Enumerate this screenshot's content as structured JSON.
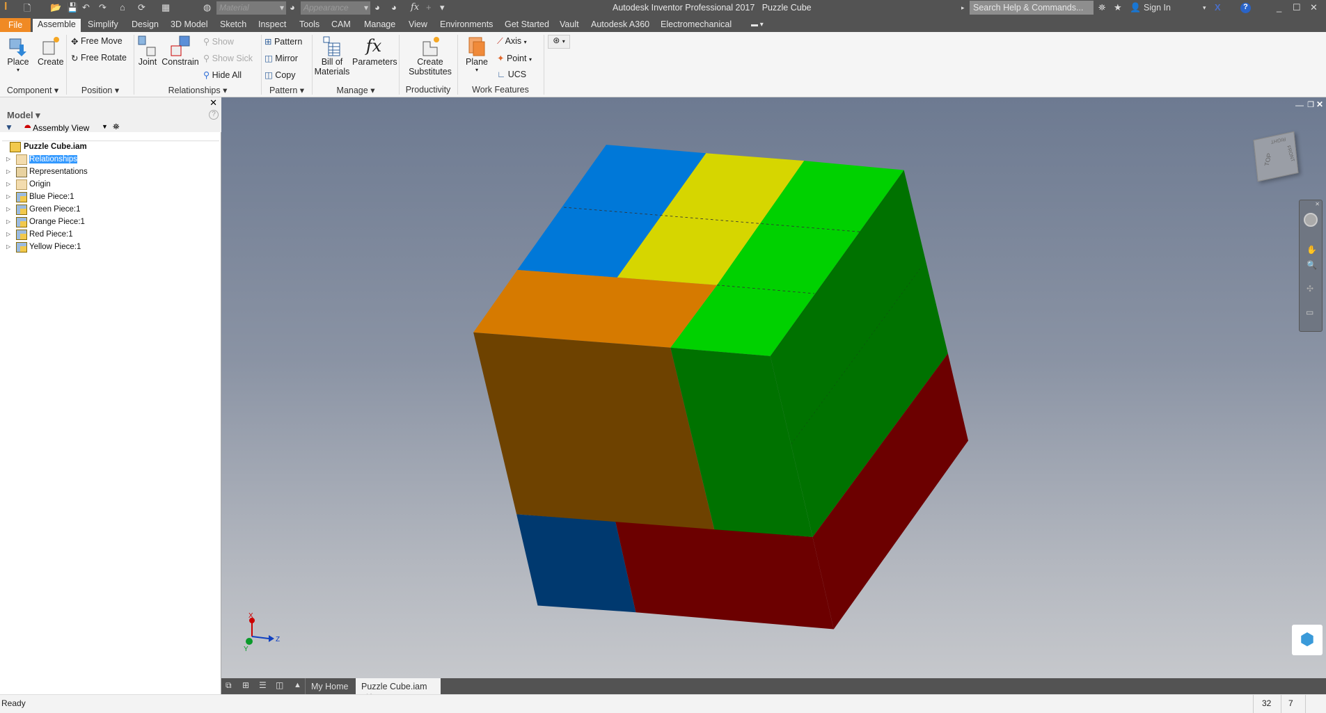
{
  "app": {
    "title": "Autodesk Inventor Professional 2017",
    "document": "Puzzle Cube",
    "logo_text": "PRO"
  },
  "quick_access": {
    "material_placeholder": "Material",
    "appearance_placeholder": "Appearance"
  },
  "help": {
    "search_placeholder": "Search Help & Commands...",
    "sign_in": "Sign In"
  },
  "ribbon_tabs": [
    "File",
    "Assemble",
    "Simplify",
    "Design",
    "3D Model",
    "Sketch",
    "Inspect",
    "Tools",
    "CAM",
    "Manage",
    "View",
    "Environments",
    "Get Started",
    "Vault",
    "Autodesk A360",
    "Electromechanical"
  ],
  "active_tab": "Assemble",
  "ribbon": {
    "component": {
      "label": "Component",
      "place": "Place",
      "create": "Create"
    },
    "position": {
      "label": "Position",
      "free_move": "Free Move",
      "free_rotate": "Free Rotate"
    },
    "relationships": {
      "label": "Relationships",
      "joint": "Joint",
      "constrain": "Constrain",
      "show": "Show",
      "show_sick": "Show Sick",
      "hide_all": "Hide All"
    },
    "pattern": {
      "label": "Pattern",
      "pattern": "Pattern",
      "mirror": "Mirror",
      "copy": "Copy"
    },
    "manage": {
      "label": "Manage",
      "bom_1": "Bill of",
      "bom_2": "Materials",
      "parameters": "Parameters"
    },
    "productivity": {
      "label": "Productivity",
      "create_1": "Create",
      "create_2": "Substitutes"
    },
    "work_features": {
      "label": "Work Features",
      "plane": "Plane",
      "axis": "Axis",
      "point": "Point",
      "ucs": "UCS"
    }
  },
  "browser": {
    "title": "Model",
    "view": "Assembly View",
    "root": "Puzzle Cube.iam",
    "items": [
      {
        "label": "Relationships",
        "icon": "folder",
        "selected": true
      },
      {
        "label": "Representations",
        "icon": "representations"
      },
      {
        "label": "Origin",
        "icon": "folder"
      },
      {
        "label": "Blue Piece:1",
        "icon": "part"
      },
      {
        "label": "Green Piece:1",
        "icon": "part"
      },
      {
        "label": "Orange Piece:1",
        "icon": "part"
      },
      {
        "label": "Red Piece:1",
        "icon": "part"
      },
      {
        "label": "Yellow Piece:1",
        "icon": "part"
      }
    ]
  },
  "viewcube": {
    "top": "TOP",
    "right": "RIGHT",
    "front": "FRONT"
  },
  "triad": {
    "x": "X",
    "y": "Y",
    "z": "Z"
  },
  "doc_tabs": {
    "home": "My Home",
    "active": "Puzzle Cube.iam"
  },
  "status": {
    "text": "Ready",
    "count1": "32",
    "count2": "7"
  },
  "colors": {
    "blue": "#0078d8",
    "yellow": "#d6d600",
    "green": "#00d100",
    "orange": "#d67a00",
    "orange_dark": "#6e4200",
    "green_dark": "#007200",
    "red_dark": "#6c0000",
    "blue_dark": "#00396f",
    "accent": "#f08a24"
  }
}
